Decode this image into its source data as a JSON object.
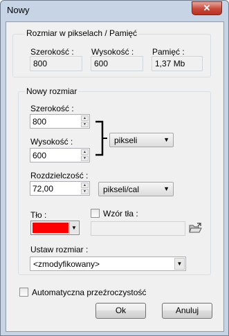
{
  "window": {
    "title": "Nowy",
    "close_glyph": "✕"
  },
  "memory_group": {
    "title": "Rozmiar w pikselach / Pamięć",
    "width_label": "Szerokość :",
    "width_value": "800",
    "height_label": "Wysokość :",
    "height_value": "600",
    "memory_label": "Pamięć :",
    "memory_value": "1,37 Mb"
  },
  "new_size_group": {
    "title": "Nowy rozmiar",
    "width_label": "Szerokość :",
    "width_value": "800",
    "height_label": "Wysokość :",
    "height_value": "600",
    "unit_value": "pikseli",
    "resolution_label": "Rozdzielczość :",
    "resolution_value": "72,00",
    "resolution_unit_value": "pikseli/cal",
    "background_label": "Tło :",
    "background_color": "#ff0000",
    "pattern_label": "Wzór tła :",
    "pattern_value": "",
    "preset_label": "Ustaw rozmiar :",
    "preset_value": "<zmodyfikowany>"
  },
  "transparency_label": "Automatyczna przeźroczystość",
  "buttons": {
    "ok": "Ok",
    "cancel": "Anuluj"
  },
  "icons": {
    "spin_up": "up-arrow-icon",
    "spin_down": "down-arrow-icon",
    "dropdown": "chevron-down-icon",
    "open_folder": "open-folder-icon"
  }
}
